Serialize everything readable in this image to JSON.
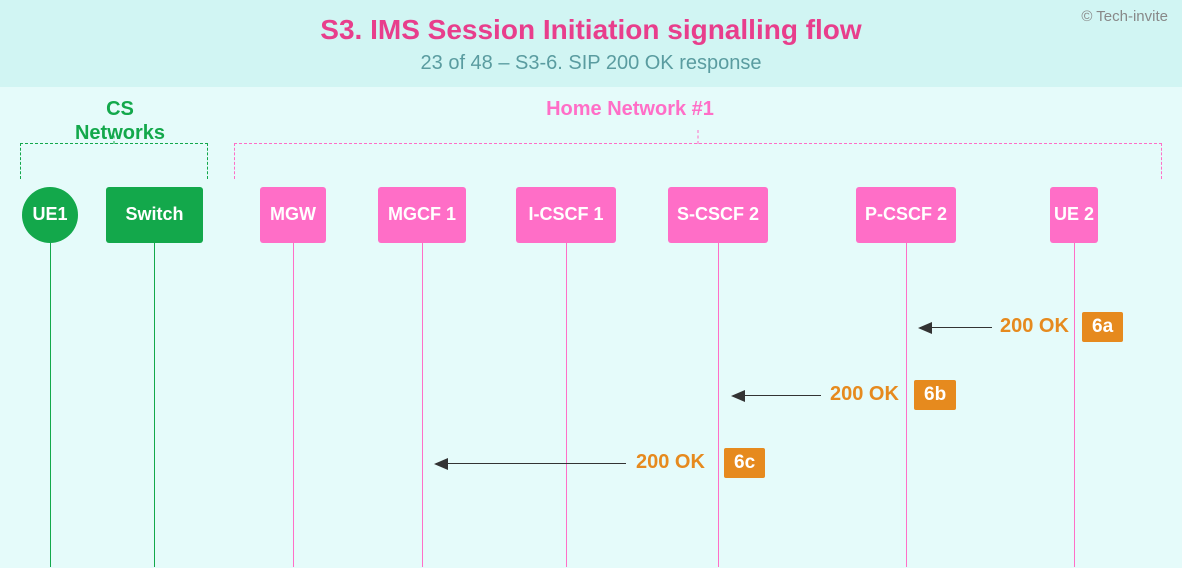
{
  "header": {
    "title": "S3. IMS Session Initiation signalling flow",
    "subtitle": "23 of 48 – S3-6. SIP 200 OK response",
    "copyright": "© Tech-invite"
  },
  "groups": {
    "cs": "CS\nNetworks",
    "home": "Home Network #1"
  },
  "nodes": {
    "ue1": {
      "label": "UE1"
    },
    "switch": {
      "label": "Switch"
    },
    "mgw": {
      "label": "MGW"
    },
    "mgcf1": {
      "label": "MGCF\n1"
    },
    "icscf1": {
      "label": "I-CSCF\n1"
    },
    "scscf2": {
      "label": "S-CSCF\n2"
    },
    "pcscf2": {
      "label": "P-CSCF\n2"
    },
    "ue2": {
      "label": "UE\n2"
    }
  },
  "messages": {
    "m6a": {
      "label": "200 OK",
      "tag": "6a"
    },
    "m6b": {
      "label": "200 OK",
      "tag": "6b"
    },
    "m6c": {
      "label": "200 OK",
      "tag": "6c"
    }
  }
}
